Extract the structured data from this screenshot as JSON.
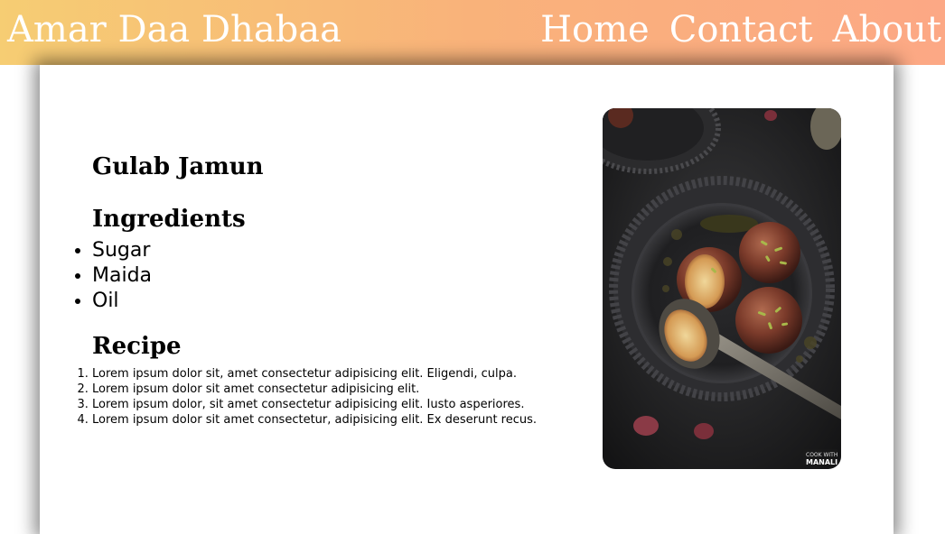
{
  "navbar": {
    "brand": "Amar Daa Dhabaa",
    "links": [
      {
        "label": "Home"
      },
      {
        "label": "Contact"
      },
      {
        "label": "About"
      }
    ]
  },
  "recipe": {
    "dish_name": "Gulab Jamun",
    "ingredients_heading": "Ingredients",
    "ingredients": [
      "Sugar",
      "Maida",
      "Oil"
    ],
    "recipe_heading": "Recipe",
    "steps": [
      "Lorem ipsum dolor sit, amet consectetur adipisicing elit. Eligendi, culpa.",
      "Lorem ipsum dolor sit amet consectetur adipisicing elit.",
      "Lorem ipsum dolor, sit amet consectetur adipisicing elit. Iusto asperiores.",
      "Lorem ipsum dolor sit amet consectetur, adipisicing elit. Ex deserunt recus."
    ],
    "photo_watermark": "COOK WITH MANALI"
  },
  "colors": {
    "navbar_gradient_start": "#f6cd73",
    "navbar_gradient_end": "#fca885",
    "nav_text": "#ffffff"
  }
}
